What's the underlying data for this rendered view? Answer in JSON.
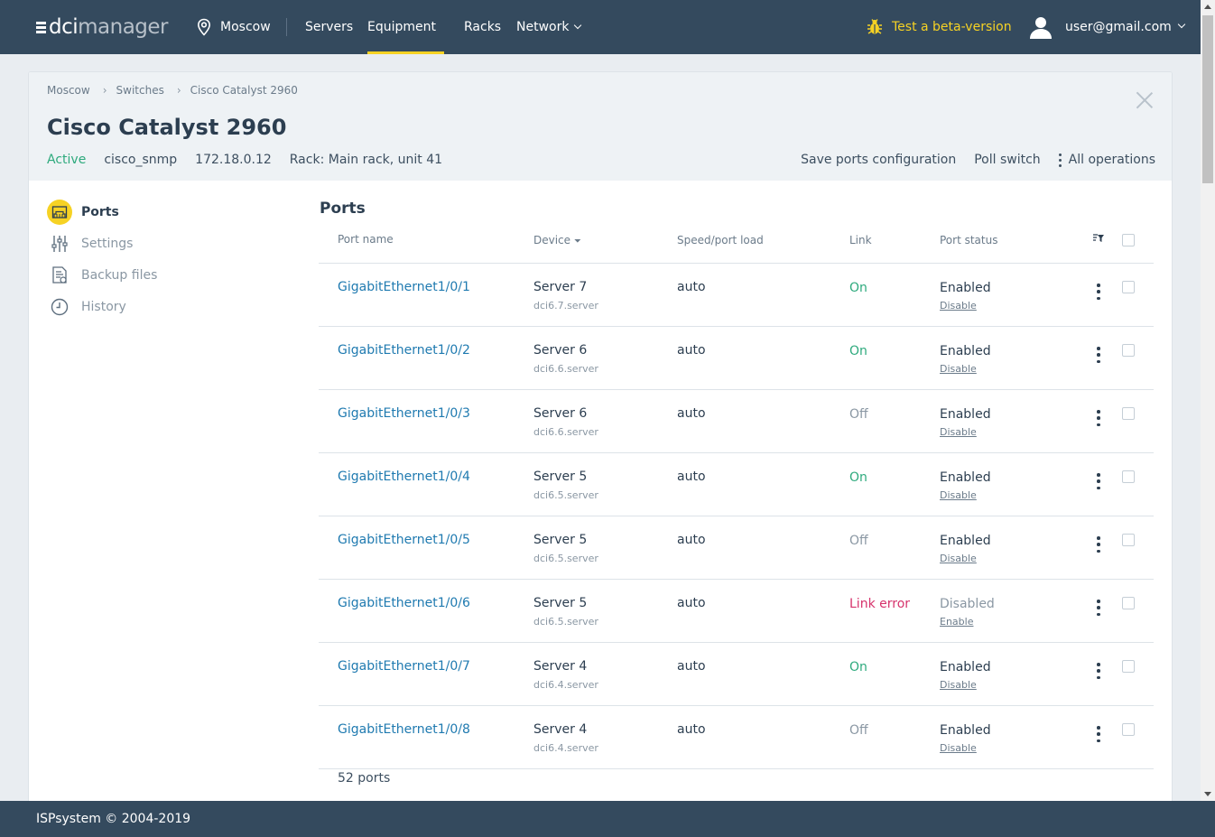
{
  "header": {
    "logo_main": "dci",
    "logo_sub": "manager",
    "location": "Moscow",
    "nav": [
      {
        "label": "Servers"
      },
      {
        "label": "Equipment"
      },
      {
        "label": "Racks"
      },
      {
        "label": "Network"
      }
    ],
    "beta_label": "Test a beta-version",
    "user_email": "user@gmail.com",
    "accent_color": "#f6d224"
  },
  "breadcrumb": [
    "Moscow",
    "Switches",
    "Cisco Catalyst 2960"
  ],
  "device": {
    "title": "Cisco Catalyst 2960",
    "status": "Active",
    "driver": "cisco_snmp",
    "ip": "172.18.0.12",
    "rack": "Rack: Main rack, unit 41"
  },
  "actions": {
    "save_ports": "Save ports configuration",
    "poll_switch": "Poll switch",
    "all_operations": "All operations"
  },
  "side_menu": [
    {
      "label": "Ports",
      "icon": "ports-icon"
    },
    {
      "label": "Settings",
      "icon": "sliders-icon"
    },
    {
      "label": "Backup files",
      "icon": "backup-file-icon"
    },
    {
      "label": "History",
      "icon": "clock-icon"
    }
  ],
  "ports": {
    "title": "Ports",
    "columns": {
      "port_name": "Port name",
      "device": "Device",
      "speed": "Speed/port load",
      "link": "Link",
      "port_status": "Port status"
    },
    "rows": [
      {
        "name": "GigabitEthernet1/0/1",
        "device": "Server 7",
        "host": "dci6.7.server",
        "speed": "auto",
        "link": "On",
        "status": "Enabled",
        "action": "Disable"
      },
      {
        "name": "GigabitEthernet1/0/2",
        "device": "Server 6",
        "host": "dci6.6.server",
        "speed": "auto",
        "link": "On",
        "status": "Enabled",
        "action": "Disable"
      },
      {
        "name": "GigabitEthernet1/0/3",
        "device": "Server 6",
        "host": "dci6.6.server",
        "speed": "auto",
        "link": "Off",
        "status": "Enabled",
        "action": "Disable"
      },
      {
        "name": "GigabitEthernet1/0/4",
        "device": "Server 5",
        "host": "dci6.5.server",
        "speed": "auto",
        "link": "On",
        "status": "Enabled",
        "action": "Disable"
      },
      {
        "name": "GigabitEthernet1/0/5",
        "device": "Server 5",
        "host": "dci6.5.server",
        "speed": "auto",
        "link": "Off",
        "status": "Enabled",
        "action": "Disable"
      },
      {
        "name": "GigabitEthernet1/0/6",
        "device": "Server 5",
        "host": "dci6.5.server",
        "speed": "auto",
        "link": "Link error",
        "status": "Disabled",
        "action": "Enable"
      },
      {
        "name": "GigabitEthernet1/0/7",
        "device": "Server 4",
        "host": "dci6.4.server",
        "speed": "auto",
        "link": "On",
        "status": "Enabled",
        "action": "Disable"
      },
      {
        "name": "GigabitEthernet1/0/8",
        "device": "Server 4",
        "host": "dci6.4.server",
        "speed": "auto",
        "link": "Off",
        "status": "Enabled",
        "action": "Disable"
      }
    ],
    "count_label": "52 ports",
    "colors": {
      "on": "#2eaa7d",
      "off": "#8a97a3",
      "error": "#d6336c",
      "disabled": "#8a97a3"
    }
  },
  "footer": {
    "copyright": "ISPsystem © 2004-2019"
  }
}
